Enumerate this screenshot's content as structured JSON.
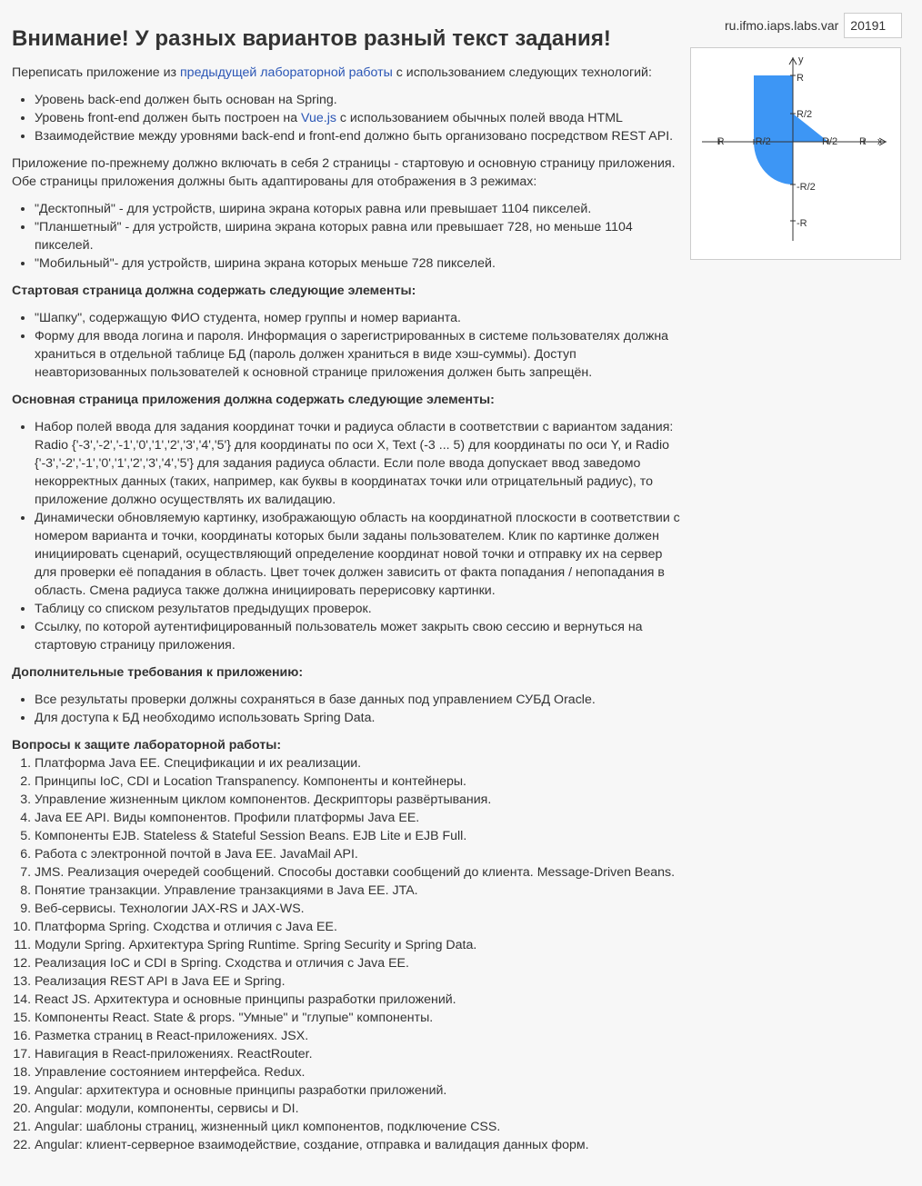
{
  "page_title": "Внимание! У разных вариантов разный текст задания!",
  "variant": {
    "label": "ru.ifmo.iaps.labs.var",
    "value": "20191"
  },
  "intro": {
    "before": "Переписать приложение из ",
    "link": "предыдущей лабораторной работы",
    "after": " с использованием следующих технологий:"
  },
  "tech_list": {
    "item1": "Уровень back-end должен быть основан на Spring.",
    "item2_before": "Уровень front-end должен быть построен на ",
    "item2_link": "Vue.js",
    "item2_after": " с использованием обычных полей ввода HTML",
    "item3": "Взаимодействие между уровнями back-end и front-end должно быть организовано посредством REST API."
  },
  "pages_paragraph": "Приложение по-прежнему должно включать в себя 2 страницы - стартовую и основную страницу приложения. Обе страницы приложения должны быть адаптированы для отображения в 3 режимах:",
  "modes": [
    "\"Десктопный\" - для устройств, ширина экрана которых равна или превышает 1104 пикселей.",
    "\"Планшетный\" - для устройств, ширина экрана которых равна или превышает 728, но меньше 1104 пикселей.",
    "\"Мобильный\"- для устройств, ширина экрана которых меньше 728 пикселей."
  ],
  "start_page": {
    "title": "Стартовая страница должна содержать следующие элементы:",
    "items": [
      "\"Шапку\", содержащую ФИО студента, номер группы и номер варианта.",
      "Форму для ввода логина и пароля. Информация о зарегистрированных в системе пользователях должна храниться в отдельной таблице БД (пароль должен храниться в виде хэш-суммы). Доступ неавторизованных пользователей к основной странице приложения должен быть запрещён."
    ]
  },
  "main_page": {
    "title": "Основная страница приложения должна содержать следующие элементы:",
    "items": [
      "Набор полей ввода для задания координат точки и радиуса области в соответствии с вариантом задания: Radio {'-3','-2','-1','0','1','2','3','4','5'} для координаты по оси X, Text (-3 ... 5) для координаты по оси Y, и Radio {'-3','-2','-1','0','1','2','3','4','5'} для задания радиуса области. Если поле ввода допускает ввод заведомо некорректных данных (таких, например, как буквы в координатах точки или отрицательный радиус), то приложение должно осуществлять их валидацию.",
      "Динамически обновляемую картинку, изображающую область на координатной плоскости в соответствии с номером варианта и точки, координаты которых были заданы пользователем. Клик по картинке должен инициировать сценарий, осуществляющий определение координат новой точки и отправку их на сервер для проверки её попадания в область. Цвет точек должен зависить от факта попадания / непопадания в область. Смена радиуса также должна инициировать перерисовку картинки.",
      "Таблицу со списком результатов предыдущих проверок.",
      "Ссылку, по которой аутентифицированный пользователь может закрыть свою сессию и вернуться на стартовую страницу приложения."
    ]
  },
  "extra": {
    "title": "Дополнительные требования к приложению:",
    "items": [
      "Все результаты проверки должны сохраняться в базе данных под управлением СУБД Oracle.",
      "Для доступа к БД необходимо использовать Spring Data."
    ]
  },
  "questions": {
    "title": "Вопросы к защите лабораторной работы:",
    "items": [
      "Платформа Java EE. Спецификации и их реализации.",
      "Принципы IoC, CDI и Location Transpanency. Компоненты и контейнеры.",
      "Управление жизненным циклом компонентов. Дескрипторы развёртывания.",
      "Java EE API. Виды компонентов. Профили платформы Java EE.",
      "Компоненты EJB. Stateless & Stateful Session Beans. EJB Lite и EJB Full.",
      "Работа с электронной почтой в Java EE. JavaMail API.",
      "JMS. Реализация очередей сообщений. Способы доставки сообщений до клиента. Message-Driven Beans.",
      "Понятие транзакции. Управление транзакциями в Java EE. JTA.",
      "Веб-сервисы. Технологии JAX-RS и JAX-WS.",
      "Платформа Spring. Сходства и отличия с Java EE.",
      "Модули Spring. Архитектура Spring Runtime. Spring Security и Spring Data.",
      "Реализация IoC и CDI в Spring. Сходства и отличия с Java EE.",
      "Реализация REST API в Java EE и Spring.",
      "React JS. Архитектура и основные принципы разработки приложений.",
      "Компоненты React. State & props. \"Умные\" и \"глупые\" компоненты.",
      "Разметка страниц в React-приложениях. JSX.",
      "Навигация в React-приложениях. ReactRouter.",
      "Управление состоянием интерфейса. Redux.",
      "Angular: архитектура и основные принципы разработки приложений.",
      "Angular: модули, компоненты, сервисы и DI.",
      "Angular: шаблоны страниц, жизненный цикл компонентов, подключение CSS.",
      "Angular: клиент-серверное взаимодействие, создание, отправка и валидация данных форм."
    ]
  },
  "graph": {
    "fill_color": "#3d96f5",
    "labels": {
      "y": "y",
      "x": "x",
      "R": "R",
      "R_half": "R/2",
      "neg_R": "-R",
      "neg_R_half": "-R/2"
    }
  }
}
